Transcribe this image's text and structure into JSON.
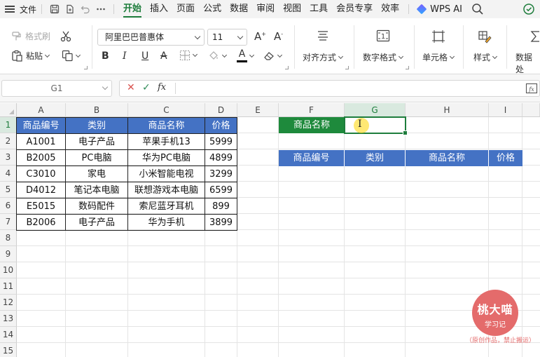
{
  "menubar": {
    "file_label": "文件",
    "tabs": [
      "开始",
      "插入",
      "页面",
      "公式",
      "数据",
      "审阅",
      "视图",
      "工具",
      "会员专享",
      "效率"
    ],
    "active_tab": "开始",
    "wps_ai": "WPS AI",
    "icons": [
      "menu-icon",
      "save-icon",
      "export-icon",
      "undo-icon",
      "more-icon",
      "search-icon",
      "cloud-sync-icon"
    ]
  },
  "ribbon": {
    "format_painter": "格式刷",
    "paste": "粘贴",
    "font_name": "阿里巴巴普惠体",
    "font_size": "11",
    "bold": "B",
    "italic": "I",
    "underline": "U",
    "strike": "A",
    "font_color_glyph": "A",
    "align": "对齐方式",
    "number_format": "数字格式",
    "cell": "单元格",
    "style": "样式",
    "data_processing": "数据处",
    "font_color_accent": "#000000"
  },
  "formula_bar": {
    "name_box": "G1",
    "formula": "",
    "cancel": "✕",
    "confirm": "✓",
    "fx": "fx"
  },
  "sheet": {
    "columns": [
      "A",
      "B",
      "C",
      "D",
      "E",
      "F",
      "G",
      "H",
      "I"
    ],
    "rows": [
      "1",
      "2",
      "3",
      "4",
      "5",
      "6",
      "7",
      "8",
      "9",
      "10",
      "11",
      "12",
      "13",
      "14",
      "15"
    ],
    "active_column": "G",
    "active_row": "1",
    "table_headers": [
      "商品编号",
      "类别",
      "商品名称",
      "价格"
    ],
    "table_rows": [
      [
        "A1001",
        "电子产品",
        "苹果手机13",
        "5999"
      ],
      [
        "B2005",
        "PC电脑",
        "华为PC电脑",
        "4899"
      ],
      [
        "C3010",
        "家电",
        "小米智能电视",
        "3299"
      ],
      [
        "D4012",
        "笔记本电脑",
        "联想游戏本电脑",
        "6599"
      ],
      [
        "E5015",
        "数码配件",
        "索尼蓝牙耳机",
        "899"
      ],
      [
        "B2006",
        "电子产品",
        "华为手机",
        "3899"
      ]
    ],
    "lookup_label": "商品名称",
    "lookup_value": "",
    "result_headers": [
      "商品编号",
      "类别",
      "商品名称",
      "价格"
    ],
    "header_color": "#4472c4",
    "lookup_label_color": "#1e8a3c"
  },
  "watermark": {
    "name": "桃大喵",
    "sub": "学习记",
    "note": "（原创作品，禁止搬运）"
  }
}
